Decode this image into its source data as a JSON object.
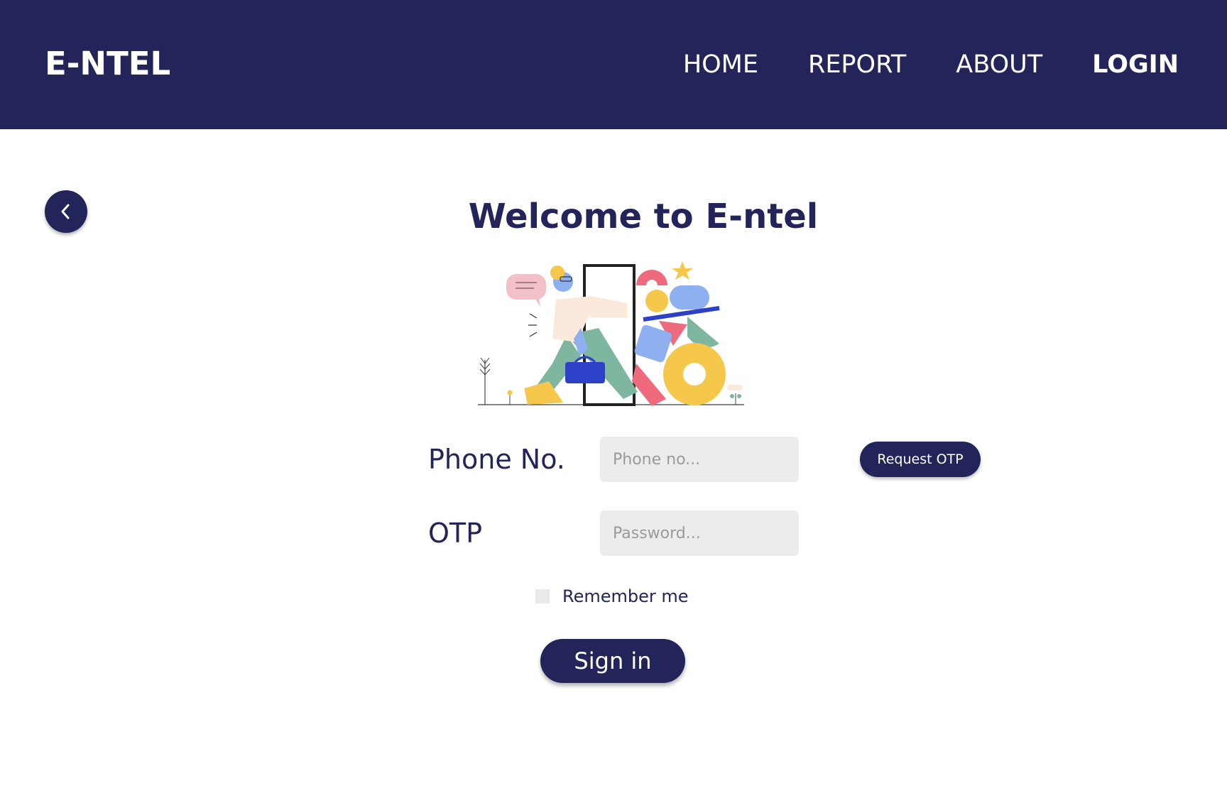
{
  "navbar": {
    "logo": "E-NTEL",
    "links": [
      {
        "label": "HOME"
      },
      {
        "label": "REPORT"
      },
      {
        "label": "ABOUT"
      },
      {
        "label": "LOGIN"
      }
    ],
    "active_link": "LOGIN",
    "background_color": "#232459"
  },
  "back_button": {
    "icon": "chevron-left-icon"
  },
  "main": {
    "title": "Welcome to E-ntel",
    "illustration": {
      "icon": "person-walking-through-door-illustration"
    }
  },
  "form": {
    "phone": {
      "label": "Phone No.",
      "placeholder": "Phone no...",
      "value": ""
    },
    "request_otp_label": "Request OTP",
    "otp": {
      "label": "OTP",
      "placeholder": "Password...",
      "value": ""
    },
    "remember": {
      "label": "Remember me",
      "checked": false
    },
    "signin_label": "Sign in"
  },
  "colors": {
    "primary": "#232459",
    "input_bg": "#ececec",
    "background": "#ffffff"
  }
}
